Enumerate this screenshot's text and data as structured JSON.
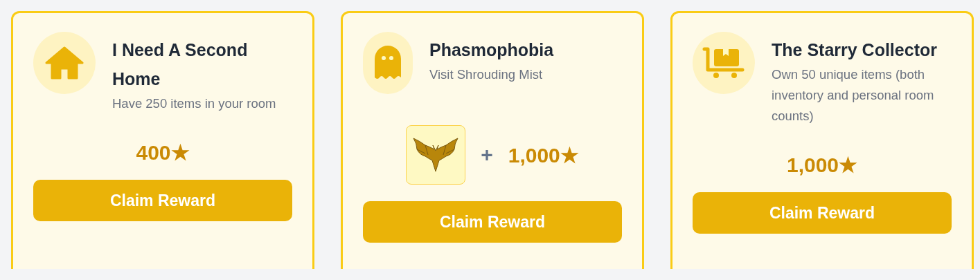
{
  "cards": [
    {
      "kind": "house",
      "title": "I Need A Second Home",
      "description": "Have 250 items in your room",
      "rewards": [
        {
          "kind": "stars",
          "text": "400★"
        }
      ],
      "button": "Claim Reward"
    },
    {
      "kind": "ghost",
      "title": "Phasmophobia",
      "description": "Visit Shrouding Mist",
      "joiner": "+",
      "rewards": [
        {
          "kind": "item"
        },
        {
          "kind": "stars",
          "text": "1,000★"
        }
      ],
      "button": "Claim Reward"
    },
    {
      "kind": "cart",
      "title": "The Starry Collector",
      "description": "Own 50 unique items (both inventory and personal room counts)",
      "rewards": [
        {
          "kind": "stars",
          "text": "1,000★"
        }
      ],
      "button": "Claim Reward"
    }
  ]
}
